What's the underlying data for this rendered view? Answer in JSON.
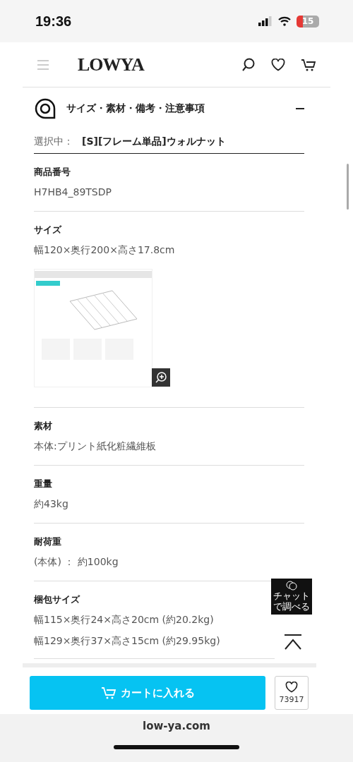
{
  "status_bar": {
    "time": "19:36",
    "battery": "15"
  },
  "header": {
    "logo": "LOWYA"
  },
  "accordion": {
    "title": "サイズ・素材・備考・注意事項",
    "expanded": true
  },
  "selection": {
    "label": "選択中：",
    "value": "[S][フレーム単品]ウォルナット"
  },
  "specs": [
    {
      "kind": "text",
      "label": "商品番号",
      "values": [
        "H7HB4_89TSDP"
      ]
    },
    {
      "kind": "image",
      "label": "サイズ",
      "values": [
        "幅120×奥行200×高さ17.8cm"
      ]
    },
    {
      "kind": "text",
      "label": "素材",
      "values": [
        "本体:プリント紙化粧繊維板"
      ]
    },
    {
      "kind": "text",
      "label": "重量",
      "values": [
        "約43kg"
      ]
    },
    {
      "kind": "text",
      "label": "耐荷重",
      "values": [
        "(本体) ： 約100kg"
      ]
    },
    {
      "kind": "text",
      "label": "梱包サイズ",
      "values": [
        "幅115×奥行24×高さ20cm (約20.2kg)",
        "幅129×奥行37×高さ15cm (約29.95kg)"
      ]
    }
  ],
  "chat_button": {
    "lines": [
      "チャット",
      "で調べる"
    ]
  },
  "footer": {
    "cart_button": "カートに入れる",
    "favorite_count": "73917"
  },
  "browser": {
    "url": "low-ya.com"
  }
}
